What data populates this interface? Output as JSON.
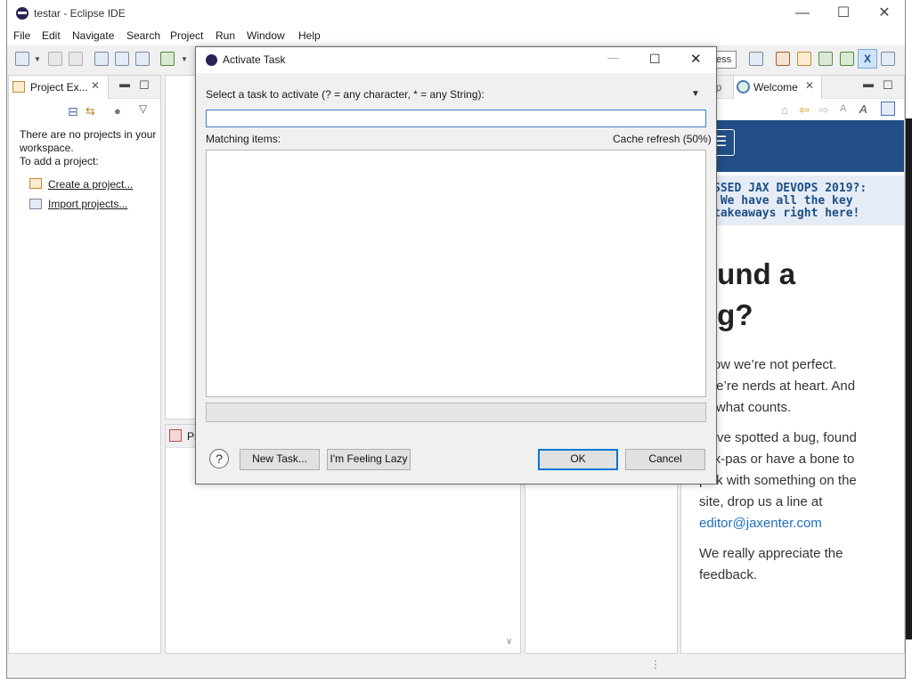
{
  "window": {
    "title": "testar - Eclipse IDE",
    "minimize": "—",
    "maximize": "☐",
    "close": "✕"
  },
  "menu": [
    "File",
    "Edit",
    "Navigate",
    "Search",
    "Project",
    "Run",
    "Window",
    "Help"
  ],
  "toolbar": {
    "search_partial": "ess"
  },
  "project_explorer": {
    "tab_label": "Project Ex...",
    "empty_message": "There are no projects in your workspace.",
    "add_prompt": "To add a project:",
    "create_link": "Create a project...",
    "import_link": "Import projects..."
  },
  "bottom_view": {
    "tab_partial": "Pr"
  },
  "right_tabs": {
    "help_partial": "lp",
    "welcome": "Welcome"
  },
  "welcome_page": {
    "banner_lines": [
      "SSED JAX DEVOPS 2019?:",
      " We have all the key",
      "takeaways right here!"
    ],
    "heading_lines": [
      "ound a",
      "ug?"
    ],
    "p1_lines": [
      "know we’re not perfect.",
      "t we’re nerds at heart. And",
      "t’s what counts."
    ],
    "p2_lines": [
      "ou’ve spotted a bug, found",
      "aux-pas or have a bone to",
      "pick with something on the",
      "site, drop us a line at"
    ],
    "email": "editor@jaxenter.com",
    "p3_lines": [
      "We really appreciate the",
      "feedback."
    ]
  },
  "dialog": {
    "title": "Activate Task",
    "prompt": "Select a task to activate (? = any character, * = any String):",
    "filter_value": "",
    "matching_label": "Matching items:",
    "cache_status": "Cache refresh (50%)",
    "help_glyph": "?",
    "new_task": "New Task...",
    "feeling_lazy": "I'm Feeling Lazy",
    "ok": "OK",
    "cancel": "Cancel"
  },
  "colors": {
    "accent": "#0078d7",
    "link": "#0b57b8",
    "welcome_header": "#214e86"
  }
}
